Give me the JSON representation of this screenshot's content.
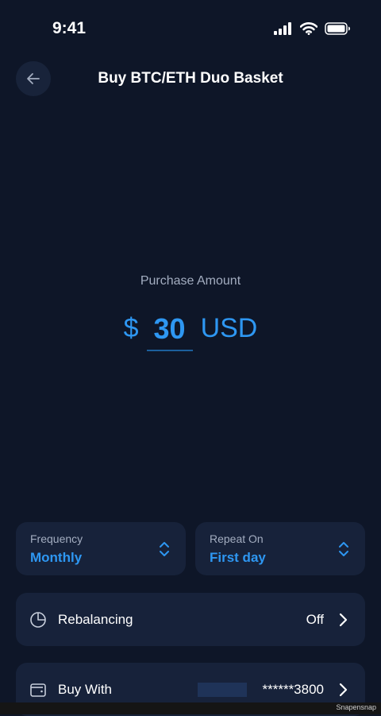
{
  "status_bar": {
    "time": "9:41",
    "icons": [
      "cellular-signal-icon",
      "wifi-icon",
      "battery-icon"
    ]
  },
  "header": {
    "back_icon": "arrow-left-icon",
    "title": "Buy BTC/ETH Duo Basket"
  },
  "amount": {
    "label": "Purchase Amount",
    "currency_symbol": "$",
    "value": "30",
    "currency_code": "USD"
  },
  "frequency": {
    "label": "Frequency",
    "value": "Monthly",
    "icon": "chevron-up-down-icon"
  },
  "repeat_on": {
    "label": "Repeat On",
    "value": "First day",
    "icon": "chevron-up-down-icon"
  },
  "rebalancing": {
    "icon": "pie-chart-icon",
    "label": "Rebalancing",
    "value": "Off",
    "chevron": "chevron-right-icon"
  },
  "buy_with": {
    "icon": "wallet-icon",
    "label": "Buy With",
    "value": "******3800",
    "chevron": "chevron-right-icon"
  },
  "watermark": {
    "text": "Snapensnap"
  },
  "colors": {
    "background": "#0E1628",
    "card": "#17223A",
    "accent": "#2E97F2",
    "muted_text": "#A3ADC0",
    "text": "#FFFFFF"
  }
}
